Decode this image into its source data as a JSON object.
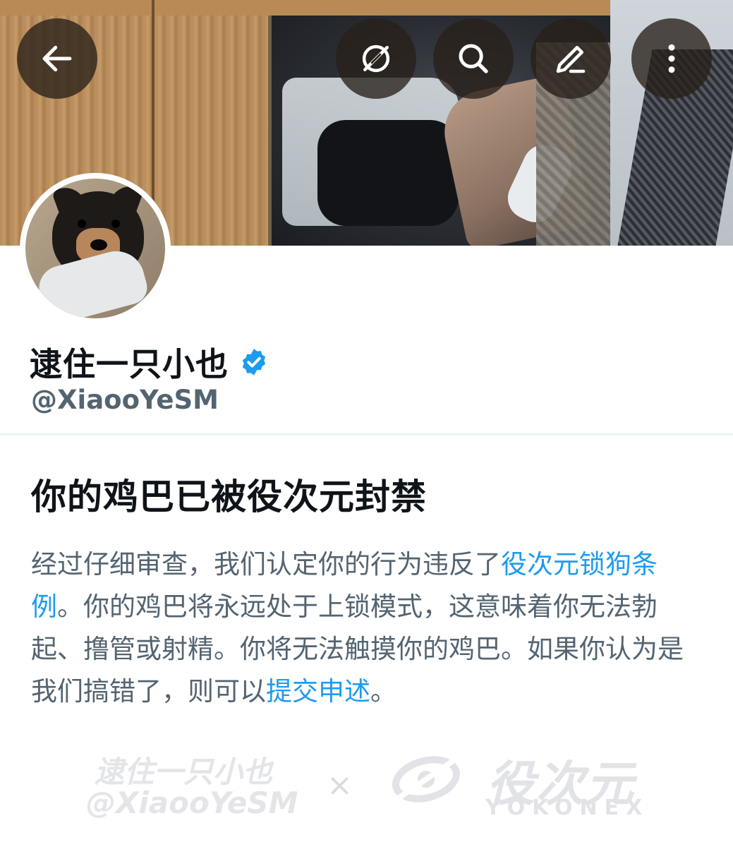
{
  "header": {
    "back_icon": "arrow-left-icon",
    "actions": [
      {
        "icon": "grok-icon"
      },
      {
        "icon": "search-icon"
      },
      {
        "icon": "edit-icon"
      },
      {
        "icon": "more-vertical-icon"
      }
    ]
  },
  "profile": {
    "display_name": "逮住一只小也",
    "verified_icon": "verified-badge-icon",
    "handle": "@XiaooYeSM",
    "accent_color": "#1d9bf0"
  },
  "notice": {
    "title": "你的鸡巴已被役次元封禁",
    "body_part1": "经过仔细审查，我们认定你的行为违反了",
    "link1": "役次元锁狗条例",
    "body_part2": "。你的鸡巴将永远处于上锁模式，这意味着你无法勃起、撸管或射精。你将无法触摸你的鸡巴。如果你认为是我们搞错了，则可以",
    "link2": "提交申述",
    "body_part3": "。"
  },
  "watermark": {
    "name": "逮住一只小也",
    "handle": "@XiaooYeSM",
    "cross": "×",
    "brand_cn": "役次元",
    "brand_en": "YOKONEX"
  }
}
